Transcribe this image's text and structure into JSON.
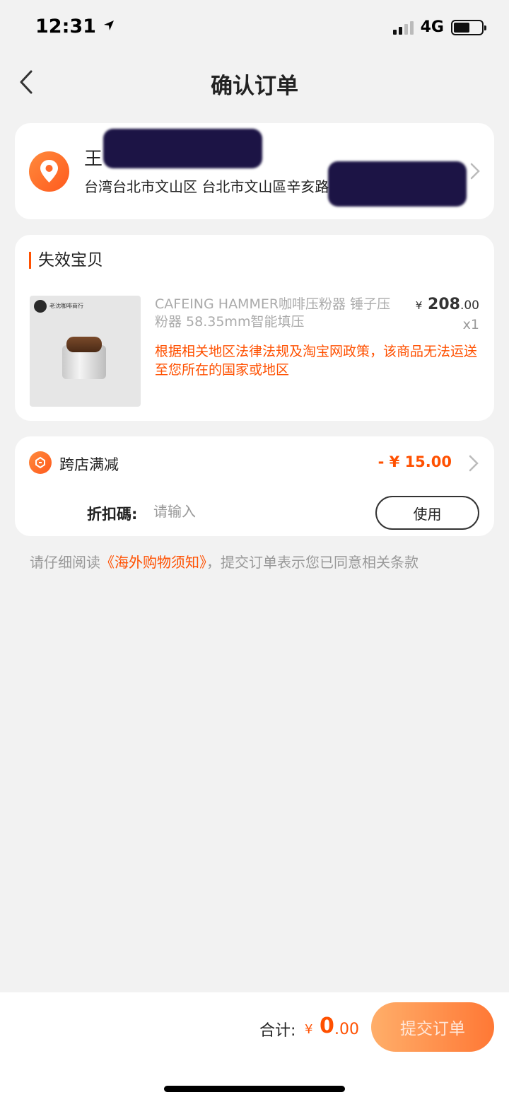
{
  "status_bar": {
    "time": "12:31",
    "network": "4G"
  },
  "nav": {
    "title": "确认订单"
  },
  "address": {
    "name": "王",
    "line": "台湾台北市文山区 台北市文山區辛亥路"
  },
  "invalid_section": {
    "title": "失效宝贝",
    "product": {
      "shop_logo_text": "老沈咖啡商行",
      "title": "CAFEING HAMMER咖啡压粉器 锤子压粉器 58.35mm智能填压",
      "price_symbol": "¥",
      "price_int": "208",
      "price_dec": ".00",
      "quantity": "x1",
      "warning": "根据相关地区法律法规及淘宝网政策，该商品无法运送至您所在的国家或地区"
    }
  },
  "discount": {
    "label": "跨店满减",
    "amount": "- ¥ 15.00",
    "coupon_label": "折扣碼:",
    "coupon_placeholder": "请输入",
    "use_button": "使用"
  },
  "notice": {
    "prefix": "请仔细阅读",
    "link": "《海外购物须知》",
    "suffix": "，提交订单表示您已同意相关条款"
  },
  "footer": {
    "total_label": "合计:",
    "currency": "¥",
    "total_int": "0",
    "total_dec": ".00",
    "submit": "提交订单"
  },
  "colors": {
    "accent": "#ff5000",
    "background": "#f2f2f2"
  }
}
